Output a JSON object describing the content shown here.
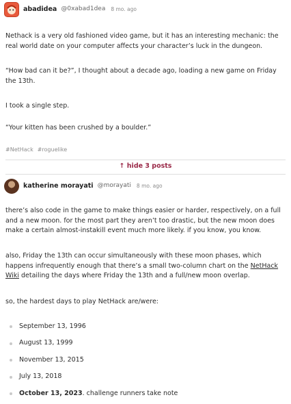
{
  "post1": {
    "username": "abadidea",
    "handle": "@0xabad1dea",
    "time": "8 mo. ago",
    "paragraphs": [
      "Nethack is a very old fashioned video game, but it has an interesting mechanic: the real world date on your computer affects your character’s luck in the dungeon.",
      "“How bad can it be?”, I thought about a decade ago, loading a new game on Friday the 13th.",
      "I took a single step.",
      "“Your kitten has been crushed by a boulder.”"
    ],
    "tags": [
      "#NetHack",
      "#roguelike"
    ]
  },
  "thread": {
    "hide_label": "↑ hide 3 posts"
  },
  "post2": {
    "username": "katherine morayati",
    "handle": "@morayati",
    "time": "8 mo. ago",
    "para1": "there’s also code in the game to make things easier or harder, respectively, on a full and a new moon. for the most part they aren’t too drastic, but the new moon does make a certain almost-instakill event much more likely. if you know, you know.",
    "para2_before": "also, Friday the 13th can occur simultaneously with these moon phases, which happens infrequently enough that there’s a small two-column chart on the ",
    "para2_link": "NetHack Wiki",
    "para2_after": " detailing the days where Friday the 13th and a full/new moon overlap.",
    "para3": "so, the hardest days to play NetHack are/were:",
    "dates": [
      "September 13, 1996",
      "August 13, 1999",
      "November 13, 2015",
      "July 13, 2018"
    ],
    "last_date": "October 13, 2023",
    "last_note": ". challenge runners take note"
  }
}
